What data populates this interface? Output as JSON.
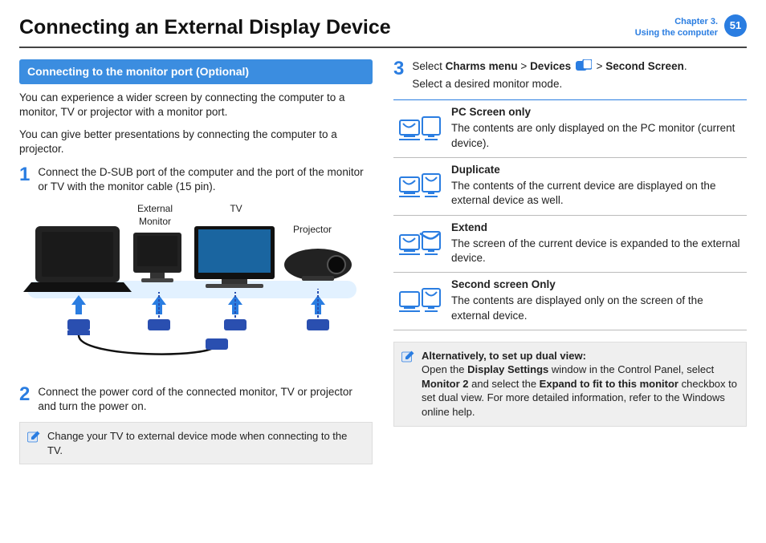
{
  "header": {
    "title": "Connecting an External Display Device",
    "chapter_line1": "Chapter 3.",
    "chapter_line2": "Using the computer",
    "page_number": "51"
  },
  "section_bar": "Connecting to the monitor port (Optional)",
  "intro_p1": "You can experience a wider screen by connecting the computer to a monitor, TV or projector with a monitor port.",
  "intro_p2": "You can give better presentations by connecting the computer to a projector.",
  "step1": {
    "num": "1",
    "text": "Connect the D-SUB port of the computer and the port of the monitor or TV with the monitor cable (15 pin)."
  },
  "diagram_labels": {
    "external_monitor_l1": "External",
    "external_monitor_l2": "Monitor",
    "tv": "TV",
    "projector": "Projector"
  },
  "step2": {
    "num": "2",
    "text": "Connect the power cord of the connected monitor, TV or projector and turn the power on."
  },
  "note_tv": "Change your TV to external device mode when connecting to the TV.",
  "step3": {
    "num": "3",
    "pre": "Select ",
    "charms": "Charms menu",
    "gt1": " > ",
    "devices": "Devices",
    "gt2": " > ",
    "second": "Second Screen",
    "period": ".",
    "line2": "Select a desired monitor mode."
  },
  "modes": [
    {
      "title": "PC Screen only",
      "desc": "The contents are only displayed on the PC monitor (current device)."
    },
    {
      "title": "Duplicate",
      "desc": "The contents of the current device are displayed on the external device as well."
    },
    {
      "title": "Extend",
      "desc": "The screen of the current device is expanded to the external device."
    },
    {
      "title": "Second screen Only",
      "desc": "The contents are displayed only on the screen of the external device."
    }
  ],
  "alt_note": {
    "lead": "Alternatively, to set up dual view:",
    "p_pre": "Open the ",
    "display_settings": "Display Settings",
    "p_mid1": " window in the Control Panel, select ",
    "monitor2": "Monitor 2",
    "p_mid2": " and select the ",
    "expand": "Expand to fit to this monitor",
    "p_end": " checkbox to set dual view. For more detailed information, refer to the Windows online help."
  }
}
